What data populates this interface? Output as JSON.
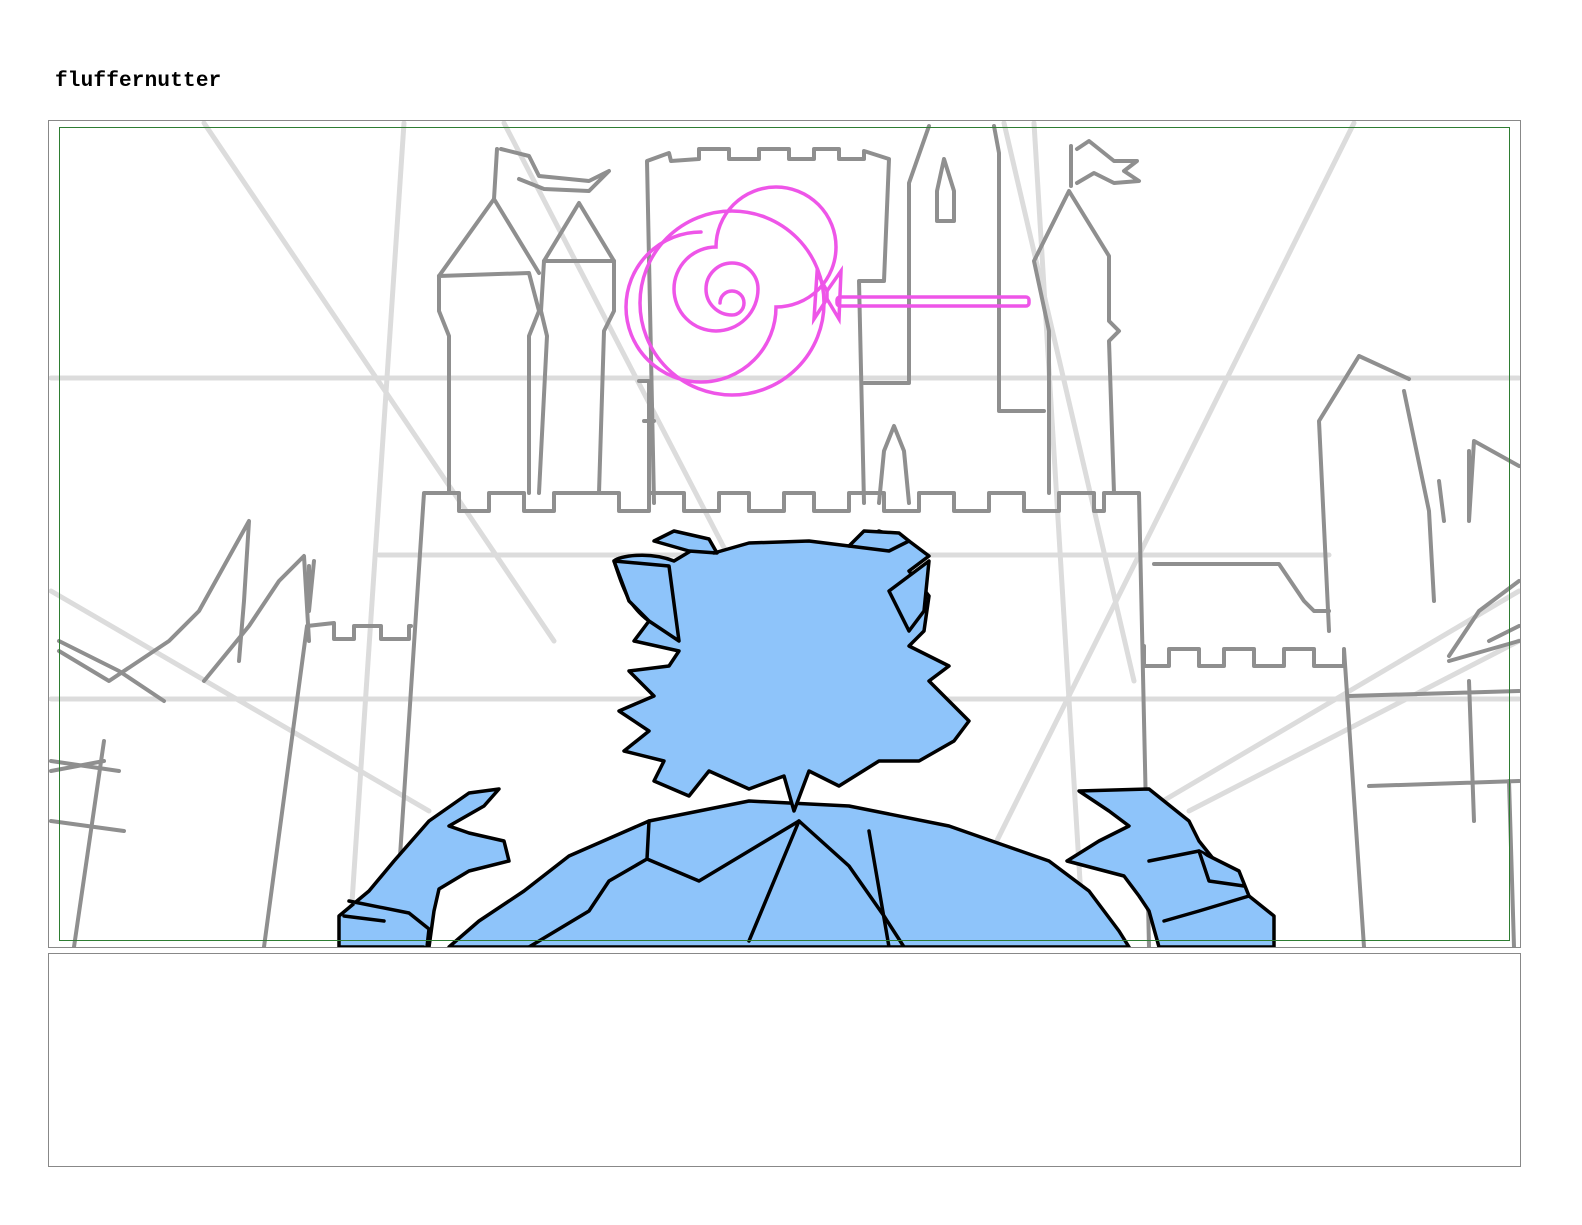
{
  "page": {
    "title": "fluffernutter"
  },
  "panel": {
    "colors": {
      "guide_lines": "#dcdcdc",
      "castle_lines": "#8f8f8f",
      "character_fill": "#8ec4fa",
      "character_outline": "#000000",
      "lollipop": "#ee55e8",
      "safe_area_border": "#2e7d32"
    }
  },
  "notes": {
    "text": ""
  }
}
